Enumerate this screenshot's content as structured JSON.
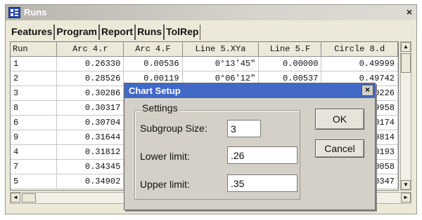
{
  "window": {
    "title": "Runs",
    "close_glyph": "×"
  },
  "tabs": [
    "Features",
    "Program",
    "Report",
    "Runs",
    "TolRep"
  ],
  "table": {
    "columns": [
      "Run",
      "Arc 4.r",
      "Arc 4.F",
      "Line 5.XYa",
      "Line 5.F",
      "Circle 8.d"
    ],
    "rows": [
      [
        "1",
        "0.26330",
        "0.00536",
        "0°13'45\"",
        "0.00000",
        "0.49999"
      ],
      [
        "2",
        "0.28526",
        "0.00119",
        "0°06'12\"",
        "0.00537",
        "0.49742"
      ],
      [
        "3",
        "0.30286",
        "",
        "",
        "",
        "0226"
      ],
      [
        "8",
        "0.30317",
        "",
        "",
        "",
        "9958"
      ],
      [
        "6",
        "0.30704",
        "",
        "",
        "",
        "0174"
      ],
      [
        "9",
        "0.31644",
        "",
        "",
        "",
        "9814"
      ],
      [
        "4",
        "0.31812",
        "",
        "",
        "",
        "0193"
      ],
      [
        "7",
        "0.34345",
        "",
        "",
        "",
        "0058"
      ],
      [
        "5",
        "0.34902",
        "",
        "",
        "",
        "0347"
      ]
    ]
  },
  "dialog": {
    "title": "Chart Setup",
    "close_glyph": "×",
    "group_label": "Settings",
    "subgroup_label": "Subgroup Size:",
    "subgroup_value": "3",
    "lower_label": "Lower limit:",
    "lower_value": ".26",
    "upper_label": "Upper limit:",
    "upper_value": ".35",
    "ok_label": "OK",
    "cancel_label": "Cancel"
  },
  "scroll": {
    "up": "▲",
    "down": "▼",
    "left": "◄",
    "right": "►"
  },
  "colors": {
    "dialog_title_bar": "#4169c5",
    "window_face": "#ece9d8"
  }
}
